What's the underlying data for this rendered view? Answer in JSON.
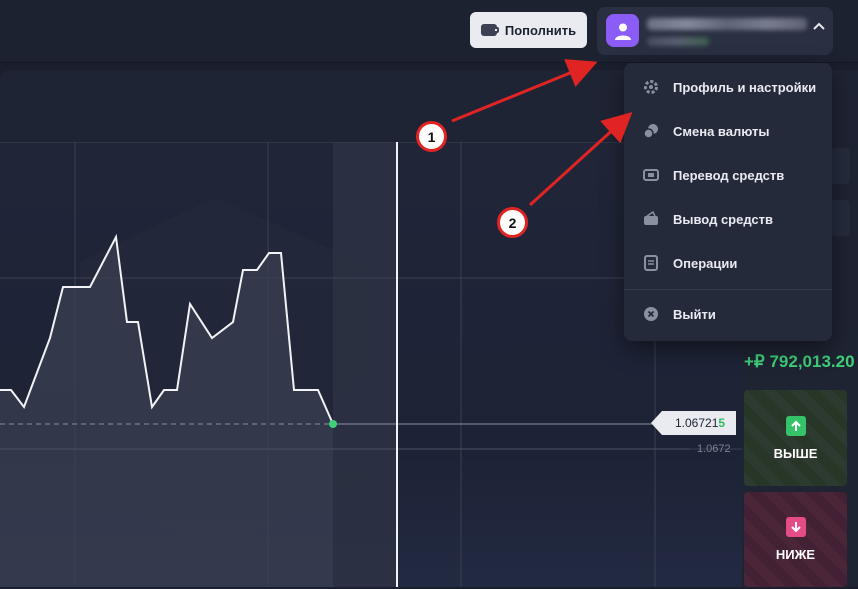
{
  "header": {
    "deposit_label": "Пополнить",
    "account": {
      "email_redacted": true,
      "avatar_color": "#8b5cf6"
    }
  },
  "menu": {
    "items": [
      {
        "label": "Профиль и настройки",
        "icon": "gear-icon"
      },
      {
        "label": "Смена валюты",
        "icon": "coins-icon"
      },
      {
        "label": "Перевод средств",
        "icon": "transfer-icon"
      },
      {
        "label": "Вывод средств",
        "icon": "wallet-icon"
      },
      {
        "label": "Операции",
        "icon": "receipt-icon"
      }
    ],
    "logout": {
      "label": "Выйти",
      "icon": "close-circle-icon"
    }
  },
  "trade": {
    "payout": "+₽ 792,013.20",
    "up_label": "ВЫШЕ",
    "down_label": "НИЖЕ",
    "up_color": "#35c36a",
    "down_color": "#e34c86"
  },
  "chart_data": {
    "type": "area",
    "current_price_main": "1.06721",
    "current_price_highlight": "5",
    "current_price_tail_label": "1.0672",
    "accent": "#3fd07a"
  },
  "annotations": [
    {
      "number": "1"
    },
    {
      "number": "2"
    }
  ],
  "colors": {
    "background": "#1b1f2d",
    "menu_bg": "#252a3b",
    "annotation_red": "#e02424"
  }
}
